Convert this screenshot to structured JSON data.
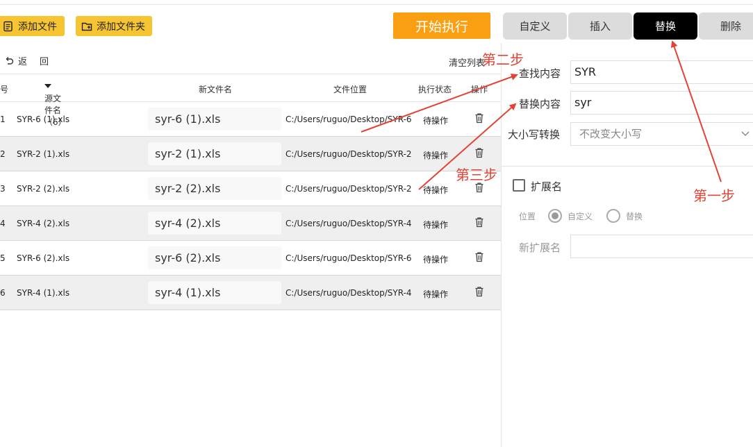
{
  "toolbar": {
    "add_file_label": "添加文件",
    "add_folder_label": "添加文件夹",
    "start_label": "开始执行",
    "modes": [
      "自定义",
      "插入",
      "替换",
      "删除"
    ],
    "active_mode": "替换"
  },
  "list_header": {
    "back_label": "返",
    "back_label_2": "回",
    "clear_label": "清空列表"
  },
  "table": {
    "columns": {
      "index": "编号",
      "source": "源文件名（6）",
      "new_name": "新文件名",
      "location": "文件位置",
      "status": "执行状态",
      "action": "操作"
    },
    "rows": [
      {
        "index": "1",
        "source": "SYR-6 (1).xls",
        "new_name": "syr-6 (1).xls",
        "location": "C:/Users/ruguo/Desktop/SYR-6",
        "status": "待操作"
      },
      {
        "index": "2",
        "source": "SYR-2 (1).xls",
        "new_name": "syr-2 (1).xls",
        "location": "C:/Users/ruguo/Desktop/SYR-2",
        "status": "待操作"
      },
      {
        "index": "3",
        "source": "SYR-2 (2).xls",
        "new_name": "syr-2 (2).xls",
        "location": "C:/Users/ruguo/Desktop/SYR-2",
        "status": "待操作"
      },
      {
        "index": "4",
        "source": "SYR-4 (2).xls",
        "new_name": "syr-4 (2).xls",
        "location": "C:/Users/ruguo/Desktop/SYR-4",
        "status": "待操作"
      },
      {
        "index": "5",
        "source": "SYR-6 (2).xls",
        "new_name": "syr-6 (2).xls",
        "location": "C:/Users/ruguo/Desktop/SYR-6",
        "status": "待操作"
      },
      {
        "index": "6",
        "source": "SYR-4 (1).xls",
        "new_name": "syr-4 (1).xls",
        "location": "C:/Users/ruguo/Desktop/SYR-4",
        "status": "待操作"
      }
    ]
  },
  "panel": {
    "find_label": "查找内容",
    "find_value": "SYR",
    "replace_label": "替换内容",
    "replace_value": "syr",
    "case_label": "大小写转换",
    "case_value": "不改变大小写",
    "ext_label": "扩展名",
    "position_label": "位置",
    "radio_custom": "自定义",
    "radio_replace": "替换",
    "new_ext_label": "新扩展名",
    "new_ext_value": ""
  },
  "annotations": {
    "step1": "第一步",
    "step2": "第二步",
    "step3": "第三步",
    "color": "#e34234"
  },
  "colors": {
    "toolbar_yellow": "#f7c531",
    "start_orange": "#fb9f12",
    "active_tab": "#000000",
    "tab_gray": "#dcdcdc"
  }
}
